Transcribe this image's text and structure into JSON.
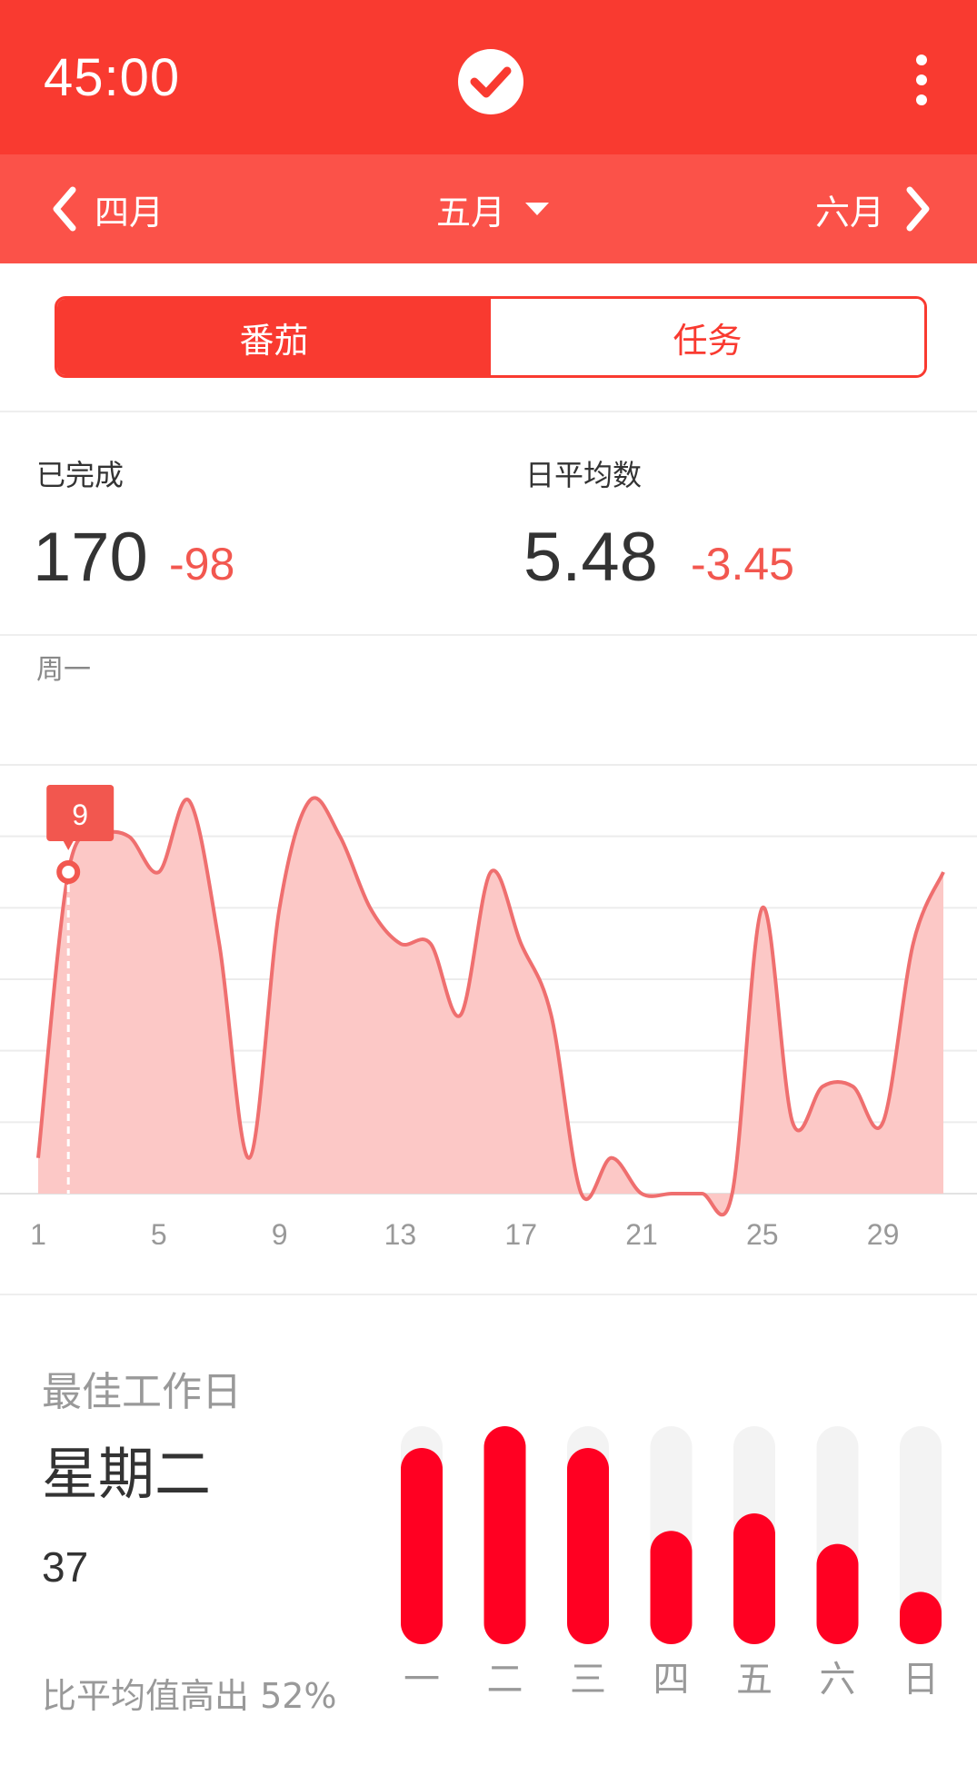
{
  "header": {
    "timer": "45:00",
    "check_icon": "check-circle-icon",
    "menu_icon": "more-vertical-icon",
    "bg_color": "#f93a30"
  },
  "month_nav": {
    "prev_label": "四月",
    "current_label": "五月",
    "next_label": "六月",
    "bg_color": "#fb5249"
  },
  "tabs": [
    {
      "label": "番茄",
      "active": true
    },
    {
      "label": "任务",
      "active": false
    }
  ],
  "stats": {
    "completed_label": "已完成",
    "completed_value": "170",
    "completed_delta": "-98",
    "daily_avg_label": "日平均数",
    "daily_avg_value": "5.48",
    "daily_avg_delta": "-3.45",
    "delta_color": "#f2574f"
  },
  "chart_section": {
    "day_label": "周一",
    "tooltip_value": "9"
  },
  "chart_data": {
    "type": "area",
    "x": [
      1,
      2,
      3,
      4,
      5,
      6,
      7,
      8,
      9,
      10,
      11,
      12,
      13,
      14,
      15,
      16,
      17,
      18,
      19,
      20,
      21,
      22,
      23,
      24,
      25,
      26,
      27,
      28,
      29,
      30,
      31
    ],
    "values": [
      1,
      9,
      10,
      10,
      9,
      11,
      7,
      1,
      8,
      11,
      10,
      8,
      7,
      7,
      5,
      9,
      7,
      5,
      0,
      1,
      0,
      0,
      0,
      0,
      8,
      2,
      3,
      3,
      2,
      7,
      9
    ],
    "xticks": [
      "1",
      "5",
      "9",
      "13",
      "17",
      "21",
      "25",
      "29"
    ],
    "ylim": [
      0,
      12
    ],
    "grid": true,
    "highlight_x": 2,
    "highlight_value": 9,
    "line_color": "#ef6f6f",
    "fill_color": "#fcc8c6"
  },
  "best_day": {
    "title": "最佳工作日",
    "day": "星期二",
    "count": "37",
    "note": "比平均值高出 52%"
  },
  "weekday_chart": {
    "days": [
      "一",
      "二",
      "三",
      "四",
      "五",
      "六",
      "日"
    ],
    "fractions": [
      0.9,
      1.0,
      0.9,
      0.52,
      0.6,
      0.46,
      0.24
    ],
    "bar_color": "#ff0022",
    "track_color": "#f3f3f3"
  }
}
